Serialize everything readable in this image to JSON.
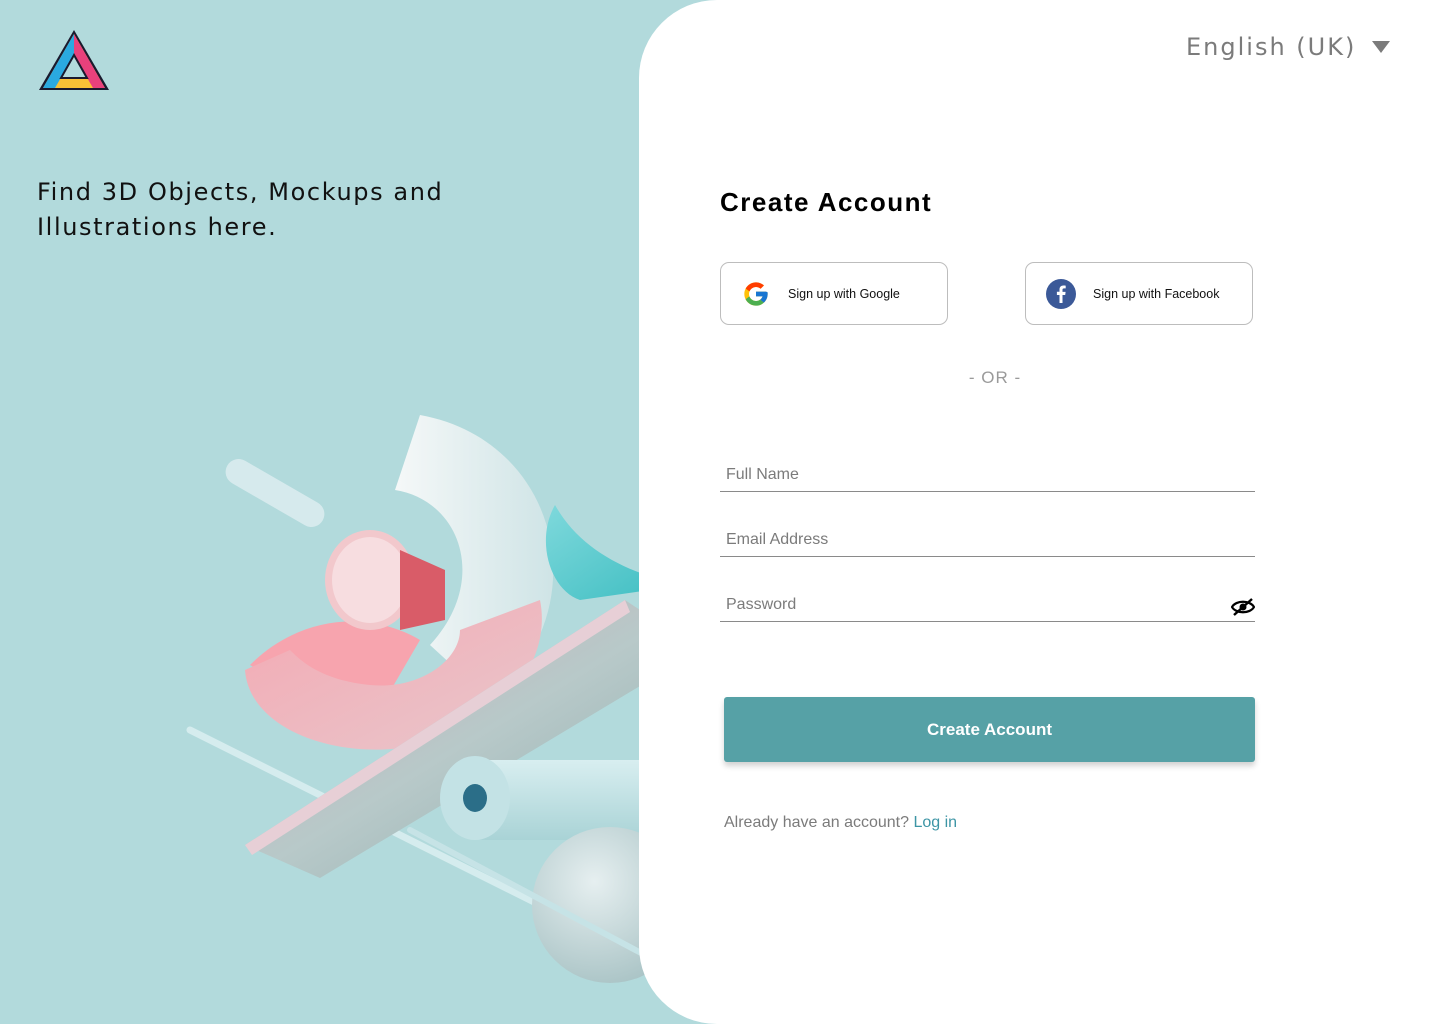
{
  "brand": {
    "accent": "#56a1a6",
    "left_bg": "#b2dadc",
    "link": "#3d95a5"
  },
  "hero": {
    "tagline": "Find 3D Objects, Mockups and Illustrations here."
  },
  "language": {
    "selected": "English (UK)"
  },
  "form": {
    "title": "Create Account",
    "google_label": "Sign up with Google",
    "facebook_label": "Sign up with Facebook",
    "divider": "- OR -",
    "full_name_placeholder": "Full Name",
    "email_placeholder": "Email Address",
    "password_placeholder": "Password",
    "submit_label": "Create Account",
    "login_prompt": "Already have an account?",
    "login_link": "Log in"
  },
  "icons": {
    "logo": "triangle-logo-icon",
    "google": "google-icon",
    "facebook": "facebook-icon",
    "password_toggle": "eye-slash-icon",
    "language_caret": "caret-down-icon"
  }
}
